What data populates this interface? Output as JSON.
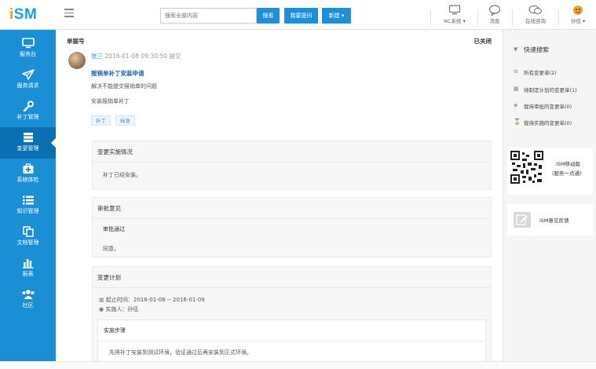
{
  "app": {
    "logo": "iSM"
  },
  "header": {
    "search_placeholder": "搜索全部内容",
    "search_button": "搜索",
    "ask_button": "我要提问",
    "new_button": "新建 ▾",
    "items": [
      {
        "label": "NC系统 ▾"
      },
      {
        "label": "消息"
      },
      {
        "label": "在线咨询"
      },
      {
        "label": "孙伍 ▾"
      }
    ]
  },
  "sidebar": {
    "items": [
      {
        "label": "服务台"
      },
      {
        "label": "服务请求"
      },
      {
        "label": "补丁管理"
      },
      {
        "label": "变更管理"
      },
      {
        "label": "系统体检"
      },
      {
        "label": "知识管理"
      },
      {
        "label": "文档管理"
      },
      {
        "label": "报表"
      },
      {
        "label": "社区"
      }
    ]
  },
  "ticket": {
    "number_label": "单据号",
    "status": "已关闭",
    "user": "张三",
    "meta": " 2016-01-08 09:30:50 提交",
    "title": "报销单补丁安装申请",
    "line1": "解决不能提交报销单的问题",
    "line2": "安装报销单补丁",
    "tags": [
      "补丁",
      "标准"
    ]
  },
  "panels": {
    "impl": {
      "title": "变更实施情况",
      "body": "补丁已经安装。"
    },
    "approval": {
      "title": "审批意见",
      "result": "审批通过",
      "comment": "同意。"
    },
    "plan": {
      "title": "变更计划",
      "time": "起止时间：2016-01-08 -- 2016-01-09",
      "implementer": "实施人：孙伍",
      "steps_title": "实施步骤",
      "steps_body": "先将补丁安装到测试环境，验证通过后再安装到正式环境。"
    }
  },
  "right": {
    "quick_search_title": "快速搜索",
    "items": [
      {
        "label": "所有变更单(2)"
      },
      {
        "label": "待制定计划的变更单(1)"
      },
      {
        "label": "我待审批的变更单(0)"
      },
      {
        "label": "我待实施的变更单(0)"
      }
    ],
    "qr_title": "iSM移动版",
    "qr_sub": "（服务一点通）",
    "feedback": "iSM意见反馈"
  },
  "colors": {
    "accent": "#1a8fd6",
    "sidebar_active": "#0b6fb3",
    "link": "#1a5fa8"
  }
}
